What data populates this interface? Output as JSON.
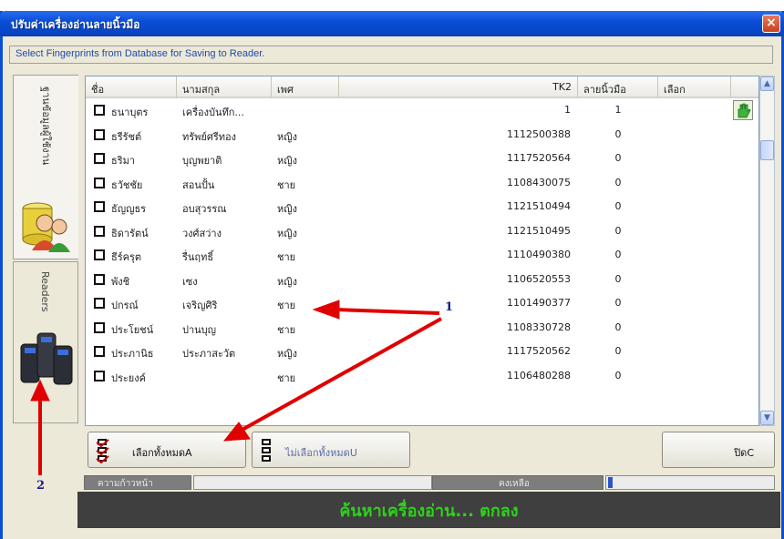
{
  "window": {
    "title": "ปรับค่าเครื่องอ่านลายนิ้วมือ",
    "close_label": "×"
  },
  "info_text": "Select Fingerprints from Database for Saving to Reader.",
  "side_tabs": [
    {
      "label": "ฐานข้อมูลผู้ใช้งาน",
      "icon": "database-users-icon"
    },
    {
      "label": "Readers",
      "icon": "fingerprint-reader-icon"
    }
  ],
  "grid": {
    "headers": [
      "ชื่อ",
      "นามสกุล",
      "เพศ",
      "TK2",
      "ลายนิ้วมือ",
      "เลือก"
    ],
    "rows": [
      {
        "name": "ธนาบุตร",
        "surname": "เครื่องบันทึก...",
        "sex": "",
        "tk2": "1",
        "fingerprints": "1",
        "selected_icon": "fingerprint-hand-icon"
      },
      {
        "name": "ธรีรัชต์",
        "surname": "ทรัพย์ศรีทอง",
        "sex": "หญิง",
        "tk2": "1112500388",
        "fingerprints": "0"
      },
      {
        "name": "ธริมา",
        "surname": "บุญพยาติ",
        "sex": "หญิง",
        "tk2": "1117520564",
        "fingerprints": "0"
      },
      {
        "name": "ธวัชชัย",
        "surname": "สอนปั้น",
        "sex": "ชาย",
        "tk2": "1108430075",
        "fingerprints": "0"
      },
      {
        "name": "ธัญญธร",
        "surname": "อบสุวรรณ",
        "sex": "หญิง",
        "tk2": "1121510494",
        "fingerprints": "0"
      },
      {
        "name": "ธิดารัตน์",
        "surname": "วงศ์สว่าง",
        "sex": "หญิง",
        "tk2": "1121510495",
        "fingerprints": "0"
      },
      {
        "name": "ธีร์ครุต",
        "surname": "รื่นฤทธิ์",
        "sex": "ชาย",
        "tk2": "1110490380",
        "fingerprints": "0"
      },
      {
        "name": "พังชิ",
        "surname": "เซง",
        "sex": "หญิง",
        "tk2": "1106520553",
        "fingerprints": "0"
      },
      {
        "name": "ปกรณ์",
        "surname": "เจริญศิริ",
        "sex": "ชาย",
        "tk2": "1101490377",
        "fingerprints": "0"
      },
      {
        "name": "ประโยชน์",
        "surname": "ปานบุญ",
        "sex": "ชาย",
        "tk2": "1108330728",
        "fingerprints": "0"
      },
      {
        "name": "ประภานิธ",
        "surname": "ประภาสะวัต",
        "sex": "หญิง",
        "tk2": "1117520562",
        "fingerprints": "0"
      },
      {
        "name": "ประยงค์",
        "surname": "",
        "sex": "ชาย",
        "tk2": "1106480288",
        "fingerprints": "0"
      }
    ]
  },
  "buttons": {
    "select_all": "เลือกทั้งหมดA",
    "deselect_all": "ไม่เลือกทั้งหมดU",
    "close": "ปิดC"
  },
  "status": {
    "progress_label": "ความก้าวหน้า",
    "remaining_label": "คงเหลือ",
    "message": "ค้นหาเครื่องอ่าน... ตกลง"
  },
  "annotations": {
    "label_1": "1",
    "label_2": "2"
  },
  "colors": {
    "titlebar": "#0a4fd6",
    "status_text": "#2dd21a",
    "annotation_arrow": "#e00000"
  }
}
